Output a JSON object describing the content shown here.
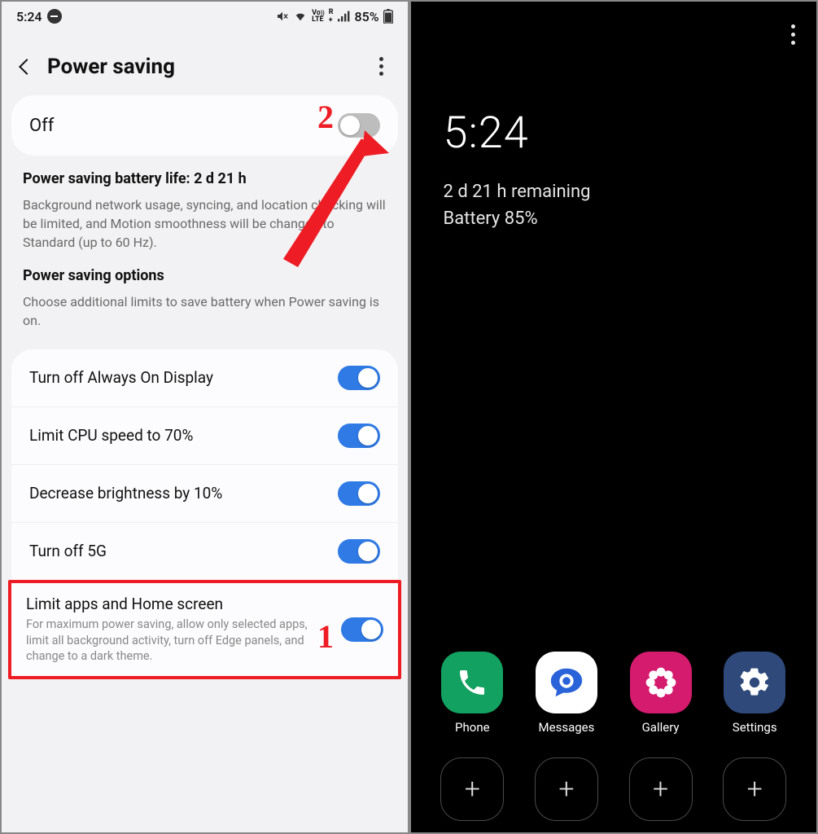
{
  "left": {
    "status": {
      "time": "5:24",
      "battery_text": "85%"
    },
    "header": {
      "title": "Power saving"
    },
    "main_toggle": {
      "label": "Off"
    },
    "info1": {
      "title": "Power saving battery life: 2 d 21 h",
      "body": "Background network usage, syncing, and location checking will be limited, and Motion smoothness will be changed to Standard (up to 60 Hz)."
    },
    "info2": {
      "title": "Power saving options",
      "body": "Choose additional limits to save battery when Power saving is on."
    },
    "options": [
      {
        "label": "Turn off Always On Display"
      },
      {
        "label": "Limit CPU speed to 70%"
      },
      {
        "label": "Decrease brightness by 10%"
      },
      {
        "label": "Turn off 5G"
      }
    ],
    "highlight": {
      "label": "Limit apps and Home screen",
      "desc": "For maximum power saving, allow only selected apps, limit all background activity, turn off Edge panels, and change to a dark theme."
    },
    "annotations": {
      "num1": "1",
      "num2": "2"
    }
  },
  "right": {
    "time": "5:24",
    "remaining": "2 d 21 h remaining",
    "battery": "Battery 85%",
    "apps": [
      {
        "label": "Phone",
        "bg": "#12a160"
      },
      {
        "label": "Messages",
        "bg": "#ffffff"
      },
      {
        "label": "Gallery",
        "bg": "#d41b6e"
      },
      {
        "label": "Settings",
        "bg": "#2f4a7a"
      }
    ]
  }
}
